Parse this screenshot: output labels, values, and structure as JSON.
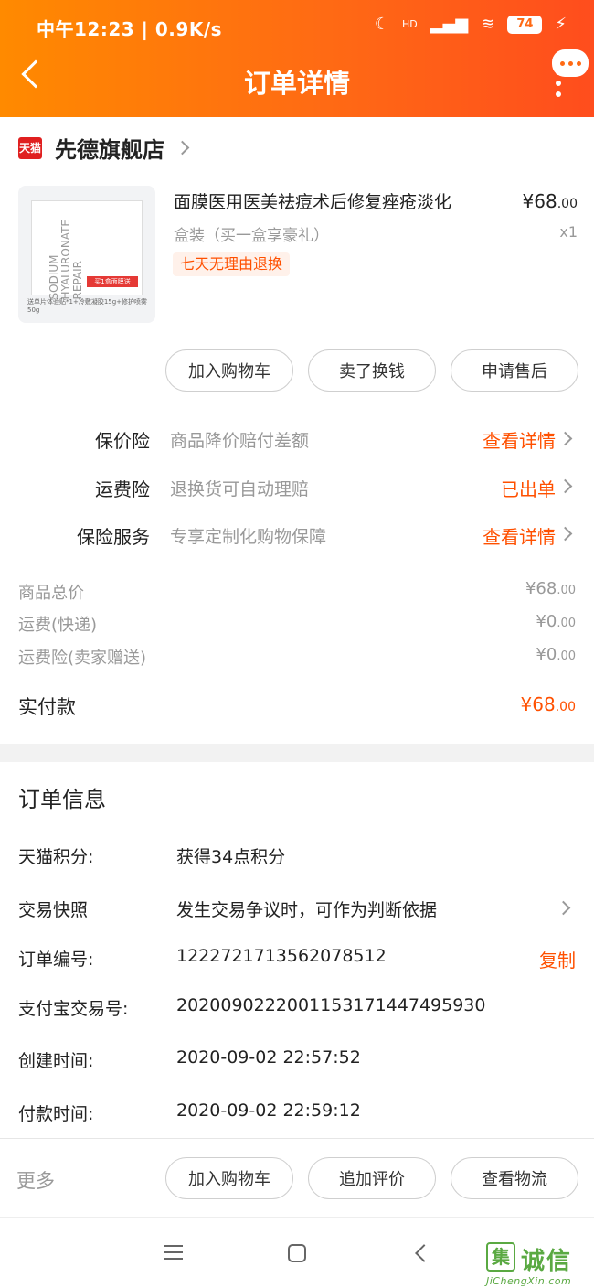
{
  "status_bar": {
    "time_speed": "中午12:23 | 0.9K/s",
    "network": "HD",
    "battery": "74"
  },
  "header": {
    "title": "订单详情"
  },
  "shop": {
    "badge": "天猫",
    "name": "先德旗舰店"
  },
  "product": {
    "image_text": "SODIUM HYALURONATE REPAIR",
    "image_tag": "买1盒面膜送",
    "image_caption": "送单片体验贴*1+冷敷凝胶15g+修护喷雾50g",
    "title": "面膜医用医美祛痘术后修复痤疮淡化",
    "price_int": "¥68",
    "price_dec": ".00",
    "sku": "盒装（买一盒享豪礼）",
    "quantity": "x1",
    "return_tag": "七天无理由退换"
  },
  "product_buttons": [
    "加入购物车",
    "卖了换钱",
    "申请售后"
  ],
  "insurance": [
    {
      "label": "保价险",
      "desc": "商品降价赔付差额",
      "link": "查看详情"
    },
    {
      "label": "运费险",
      "desc": "退换货可自动理赔",
      "link": "已出单"
    },
    {
      "label": "保险服务",
      "desc": "专享定制化购物保障",
      "link": "查看详情"
    }
  ],
  "totals": [
    {
      "label": "商品总价",
      "amount_int": "¥68",
      "amount_dec": ".00"
    },
    {
      "label": "运费(快递)",
      "amount_int": "¥0",
      "amount_dec": ".00"
    },
    {
      "label": "运费险(卖家赠送)",
      "amount_int": "¥0",
      "amount_dec": ".00"
    }
  ],
  "paid": {
    "label": "实付款",
    "amount_int": "¥68",
    "amount_dec": ".00"
  },
  "order_info": {
    "title": "订单信息",
    "rows": [
      {
        "label": "天猫积分:",
        "value": "获得34点积分"
      },
      {
        "label": "交易快照",
        "value": "发生交易争议时，可作为判断依据"
      },
      {
        "label": "订单编号:",
        "value": "1222721713562078512"
      },
      {
        "label": "支付宝交易号:",
        "value": "2020090222001153171447495930"
      },
      {
        "label": "创建时间:",
        "value": "2020-09-02 22:57:52"
      },
      {
        "label": "付款时间:",
        "value": "2020-09-02 22:59:12"
      }
    ],
    "copy_label": "复制"
  },
  "bottom": {
    "more_label": "更多",
    "buttons": [
      "加入购物车",
      "追加评价",
      "查看物流"
    ]
  },
  "watermark": {
    "char": "集",
    "text": "诚信",
    "url": "JiChengXin.com"
  },
  "colors": {
    "accent": "#ff5000",
    "header_start": "#ff8a00",
    "header_end": "#ff4d1d"
  }
}
